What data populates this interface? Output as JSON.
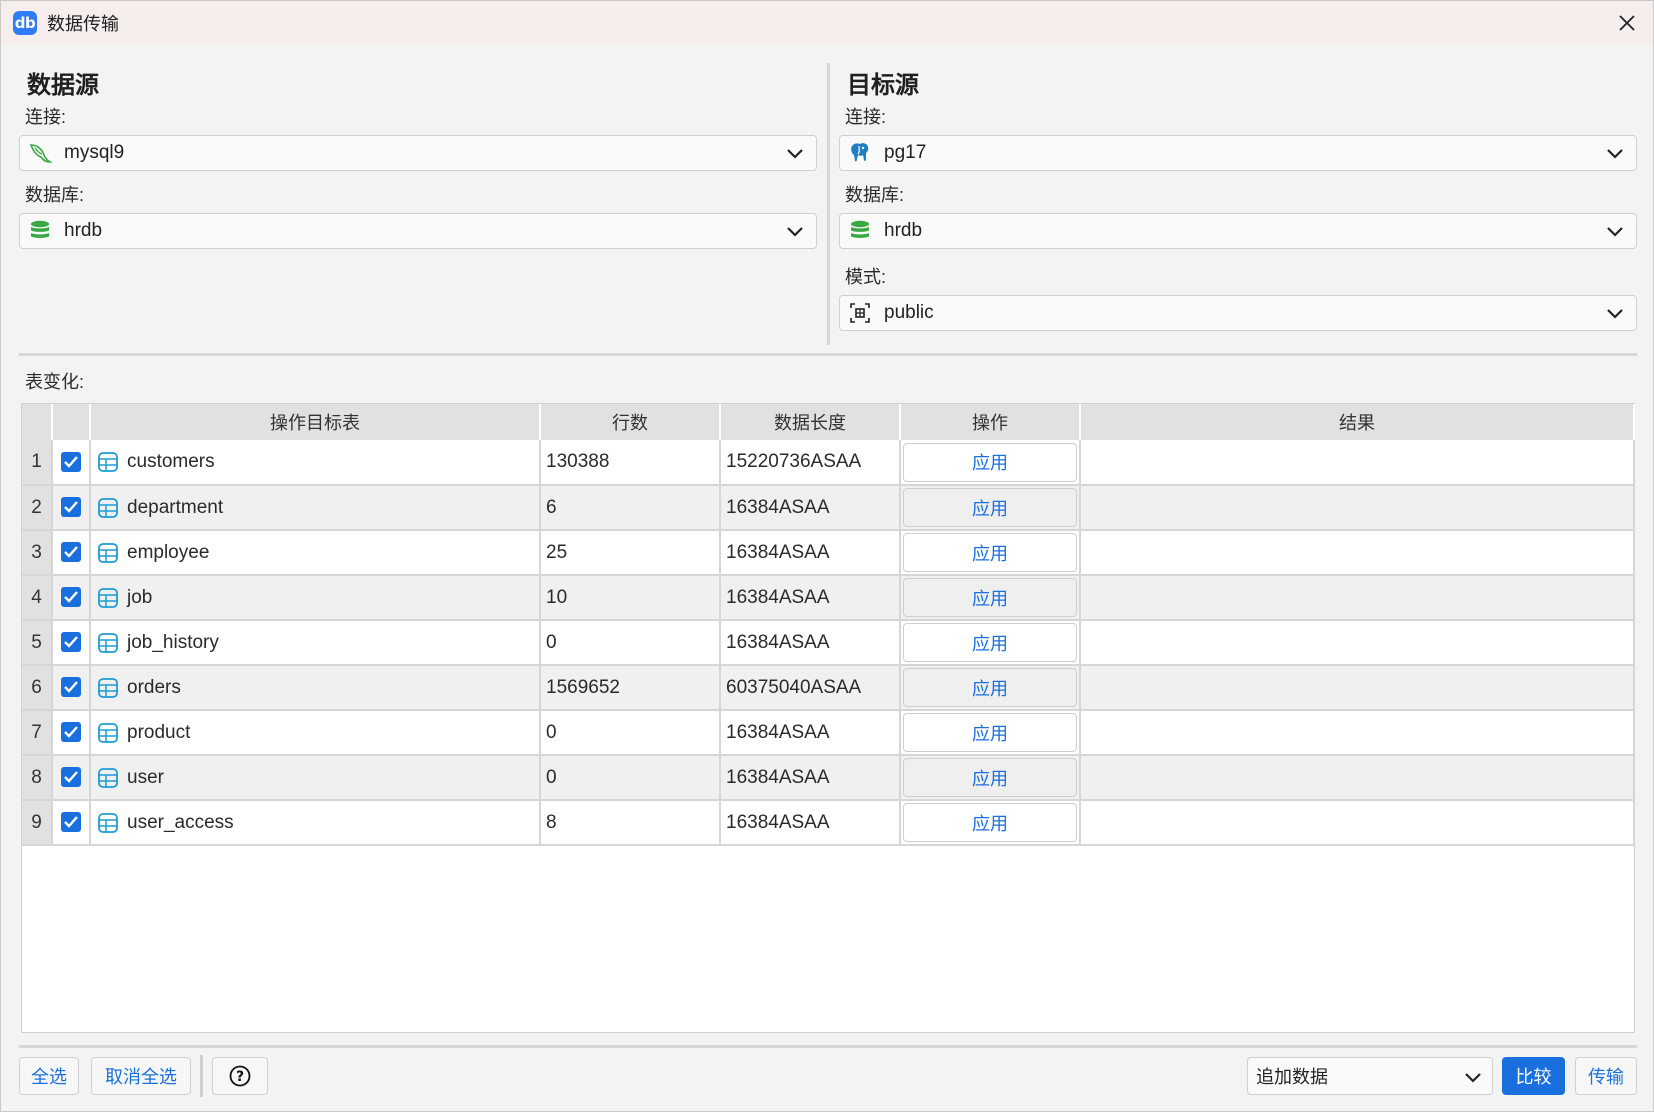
{
  "window": {
    "title": "数据传输",
    "app_icon_text": "db"
  },
  "source": {
    "heading": "数据源",
    "connection_label": "连接:",
    "connection_value": "mysql9",
    "database_label": "数据库:",
    "database_value": "hrdb"
  },
  "target": {
    "heading": "目标源",
    "connection_label": "连接:",
    "connection_value": "pg17",
    "database_label": "数据库:",
    "database_value": "hrdb",
    "schema_label": "模式:",
    "schema_value": "public"
  },
  "table_section": {
    "label": "表变化:",
    "columns": [
      "",
      "",
      "操作目标表",
      "行数",
      "数据长度",
      "操作",
      "结果"
    ],
    "rows": [
      {
        "num": "1",
        "checked": true,
        "name": "customers",
        "rows": "130388",
        "length": "15220736ASAA",
        "action": "应用",
        "result": ""
      },
      {
        "num": "2",
        "checked": true,
        "name": "department",
        "rows": "6",
        "length": "16384ASAA",
        "action": "应用",
        "result": ""
      },
      {
        "num": "3",
        "checked": true,
        "name": "employee",
        "rows": "25",
        "length": "16384ASAA",
        "action": "应用",
        "result": ""
      },
      {
        "num": "4",
        "checked": true,
        "name": "job",
        "rows": "10",
        "length": "16384ASAA",
        "action": "应用",
        "result": ""
      },
      {
        "num": "5",
        "checked": true,
        "name": "job_history",
        "rows": "0",
        "length": "16384ASAA",
        "action": "应用",
        "result": ""
      },
      {
        "num": "6",
        "checked": true,
        "name": "orders",
        "rows": "1569652",
        "length": "60375040ASAA",
        "action": "应用",
        "result": ""
      },
      {
        "num": "7",
        "checked": true,
        "name": "product",
        "rows": "0",
        "length": "16384ASAA",
        "action": "应用",
        "result": ""
      },
      {
        "num": "8",
        "checked": true,
        "name": "user",
        "rows": "0",
        "length": "16384ASAA",
        "action": "应用",
        "result": ""
      },
      {
        "num": "9",
        "checked": true,
        "name": "user_access",
        "rows": "8",
        "length": "16384ASAA",
        "action": "应用",
        "result": ""
      }
    ]
  },
  "footer": {
    "select_all": "全选",
    "deselect_all": "取消全选",
    "help_symbol": "?",
    "mode_value": "追加数据",
    "compare": "比较",
    "transfer": "传输"
  },
  "icons": {
    "app": "db-logo-icon",
    "close": "close-icon",
    "mysql": "mysql-dolphin-icon",
    "postgres": "postgres-elephant-icon",
    "database": "database-stack-icon",
    "schema": "schema-icon",
    "table": "table-grid-icon",
    "chevron": "chevron-down-icon",
    "help": "help-circle-icon"
  },
  "colors": {
    "accent": "#1a6fde",
    "titlebar": "#f6eded",
    "table_icon": "#1e9bd4",
    "db_icon": "#3aa843"
  }
}
